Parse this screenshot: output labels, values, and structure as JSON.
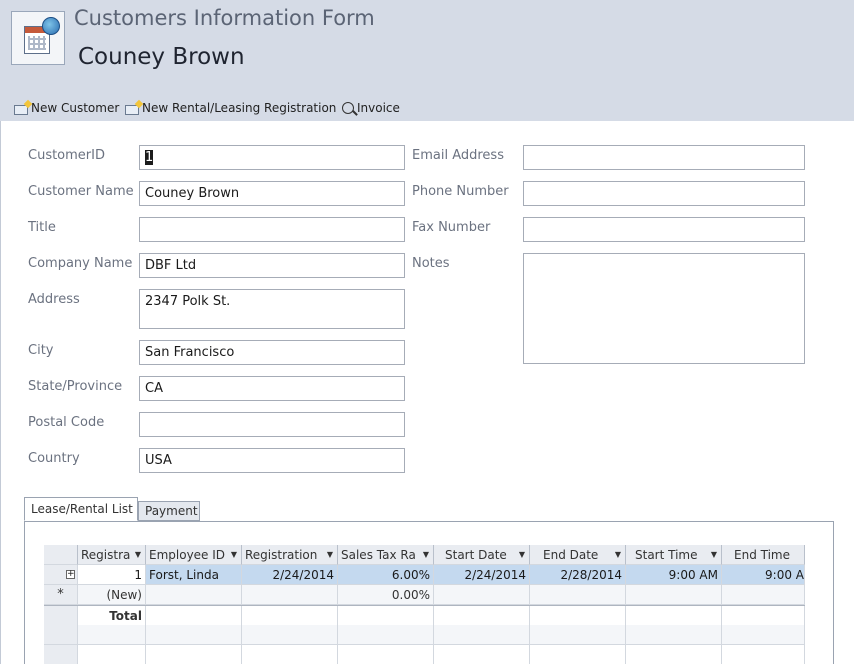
{
  "header": {
    "form_title": "Customers Information Form",
    "record_name": "Couney Brown"
  },
  "toolbar": {
    "new_customer": "New Customer",
    "new_registration": "New Rental/Leasing Registration",
    "invoice": "Invoice"
  },
  "fields": {
    "customer_id": {
      "label": "CustomerID",
      "value": "1"
    },
    "customer_name": {
      "label": "Customer Name",
      "value": "Couney Brown"
    },
    "title": {
      "label": "Title",
      "value": ""
    },
    "company_name": {
      "label": "Company Name",
      "value": "DBF Ltd"
    },
    "address": {
      "label": "Address",
      "value": "2347 Polk St."
    },
    "city": {
      "label": "City",
      "value": "San Francisco"
    },
    "state": {
      "label": "State/Province",
      "value": "CA"
    },
    "postal_code": {
      "label": "Postal Code",
      "value": ""
    },
    "country": {
      "label": "Country",
      "value": "USA"
    },
    "email": {
      "label": "Email Address",
      "value": ""
    },
    "phone": {
      "label": "Phone Number",
      "value": ""
    },
    "fax": {
      "label": "Fax Number",
      "value": ""
    },
    "notes": {
      "label": "Notes",
      "value": ""
    }
  },
  "tabs": {
    "lease": "Lease/Rental List",
    "payment": "Payment"
  },
  "datasheet": {
    "columns": [
      "Registra",
      "Employee ID",
      "Registration",
      "Sales Tax Ra",
      "Start Date",
      "End Date",
      "Start Time",
      "End Time"
    ],
    "row1": {
      "registration_id": "1",
      "employee": "Forst, Linda",
      "registration_date": "2/24/2014",
      "sales_tax": "6.00%",
      "start_date": "2/24/2014",
      "end_date": "2/28/2014",
      "start_time": "9:00 AM",
      "end_time": "9:00 A"
    },
    "new_row": {
      "marker": "*",
      "label": "(New)",
      "sales_tax": "0.00%"
    },
    "total_label": "Total"
  },
  "colors": {
    "header_bg": "#d5dbe6",
    "selected_row": "#c4d9ef"
  }
}
